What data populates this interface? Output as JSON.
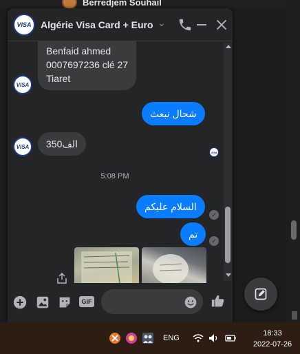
{
  "background": {
    "contact_name": "Berredjem Souhail"
  },
  "chat": {
    "title": "Algérie Visa Card + Euro",
    "avatar_label": "VISA",
    "messages": [
      {
        "direction": "in",
        "lines": [
          "Benfaid ahmed",
          "0007697236 clé 27",
          "Tiaret"
        ]
      },
      {
        "direction": "out",
        "text": "شحال نبعث"
      },
      {
        "direction": "in",
        "text": "350الف"
      },
      {
        "direction": "out",
        "text": "السلام عليكم"
      },
      {
        "direction": "out",
        "text": "تم"
      }
    ],
    "time_separator": "5:08 PM",
    "composer": {
      "gif_label": "GIF",
      "placeholder": ""
    }
  },
  "taskbar": {
    "language": "ENG",
    "time": "18:33",
    "date": "2022-07-26"
  },
  "colors": {
    "accent": "#0a7cff",
    "chat_bg": "#242526",
    "bubble_in": "#3a3b3c",
    "taskbar": "#2d1d13"
  }
}
